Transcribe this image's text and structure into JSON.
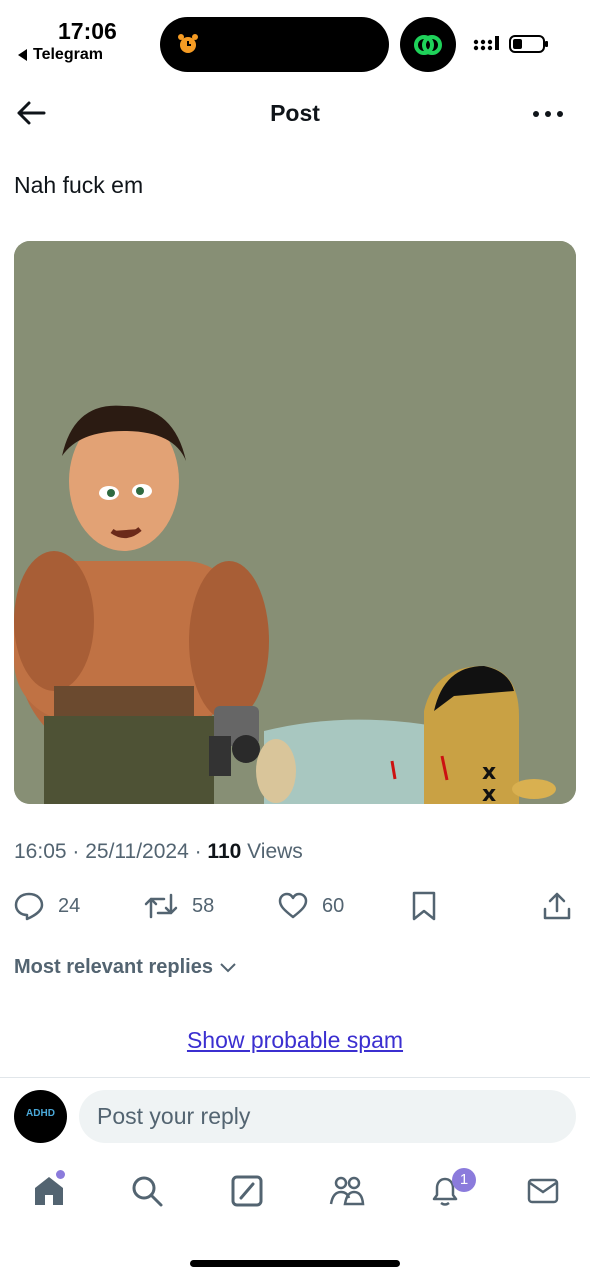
{
  "status_bar": {
    "time": "17:06",
    "back_app": "Telegram"
  },
  "header": {
    "title": "Post"
  },
  "post": {
    "text": "Nah fuck em",
    "meta_prefix": "16:05 · 25/11/2024 · ",
    "views_count": "110",
    "views_label": " Views"
  },
  "actions": {
    "replies": "24",
    "reposts": "58",
    "likes": "60"
  },
  "replies": {
    "sort_label": "Most relevant replies",
    "spam_link": "Show probable spam",
    "input_placeholder": "Post your reply",
    "avatar_text": "ADHD"
  },
  "tabbar": {
    "notifications_badge": "1"
  },
  "colors": {
    "accent": "#3b2fd0",
    "badge": "#8b7bdc",
    "muted": "#536471",
    "media_bg": "#878f75"
  }
}
